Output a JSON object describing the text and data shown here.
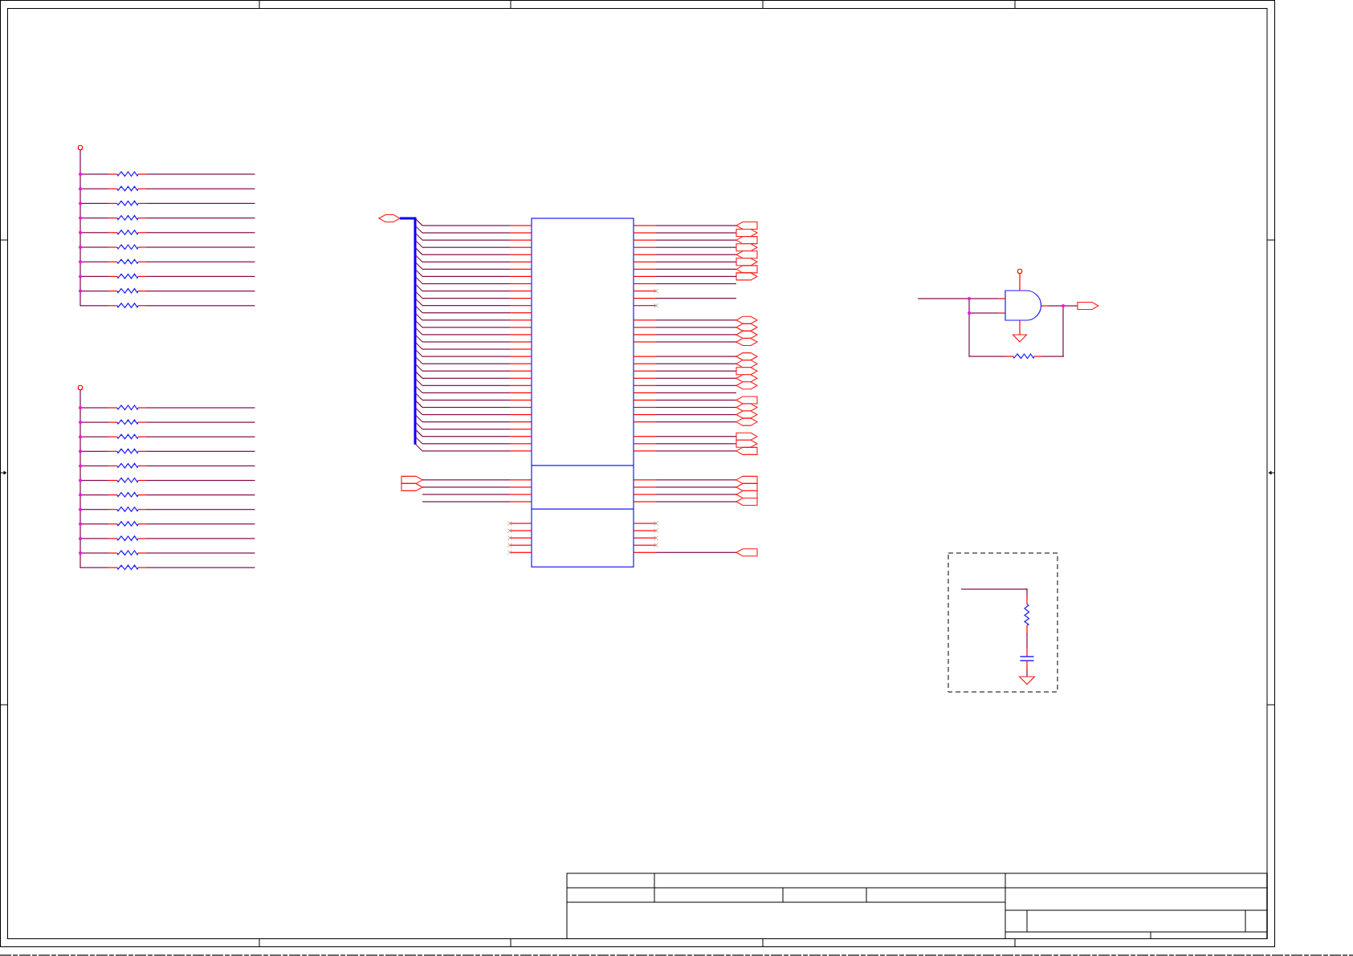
{
  "pullup_banks": [
    {
      "resistors": [
        {
          "junction": true
        },
        {
          "junction": true
        },
        {
          "junction": true
        },
        {
          "junction": true
        },
        {
          "junction": true
        },
        {
          "junction": true
        },
        {
          "junction": true
        },
        {
          "junction": true
        },
        {
          "junction": true
        },
        {
          "junction": false
        }
      ]
    },
    {
      "resistors": [
        {
          "junction": true
        },
        {
          "junction": true
        },
        {
          "junction": true
        },
        {
          "junction": true
        },
        {
          "junction": true
        },
        {
          "junction": true
        },
        {
          "junction": true
        },
        {
          "junction": true
        },
        {
          "junction": true
        },
        {
          "junction": true
        },
        {
          "junction": true
        },
        {
          "junction": false
        }
      ]
    }
  ],
  "chip": {
    "bus_port": {
      "kind": "port-bidir"
    },
    "sections": [
      {
        "left_pins": [
          {
            "kind": "bus"
          },
          {
            "kind": "bus"
          },
          {
            "kind": "bus"
          },
          {
            "kind": "bus"
          },
          {
            "kind": "bus"
          },
          {
            "kind": "bus"
          },
          {
            "kind": "bus"
          },
          {
            "kind": "bus"
          },
          {
            "kind": "bus"
          },
          {
            "kind": "bus"
          },
          {
            "kind": "bus"
          },
          {
            "kind": "bus"
          },
          {
            "kind": "bus"
          },
          {
            "kind": "bus"
          },
          {
            "kind": "bus"
          },
          {
            "kind": "bus"
          },
          {
            "kind": "bus"
          },
          {
            "kind": "bus"
          },
          {
            "kind": "bus"
          },
          {
            "kind": "bus"
          },
          {
            "kind": "bus"
          },
          {
            "kind": "bus"
          },
          {
            "kind": "bus"
          },
          {
            "kind": "bus"
          },
          {
            "kind": "bus"
          },
          {
            "kind": "bus"
          },
          {
            "kind": "bus"
          },
          {
            "kind": "bus"
          },
          {
            "kind": "bus"
          },
          {
            "kind": "bus"
          },
          {
            "kind": "bus"
          },
          {
            "kind": "bus"
          }
        ],
        "right_pins": [
          {
            "kind": "port-in"
          },
          {
            "kind": "port-out"
          },
          {
            "kind": "port-in"
          },
          {
            "kind": "port-out"
          },
          {
            "kind": "port-in"
          },
          {
            "kind": "port-out"
          },
          {
            "kind": "port-in"
          },
          {
            "kind": "port-out"
          },
          {
            "kind": "wire"
          },
          {
            "kind": "no-connect"
          },
          {
            "kind": "wire"
          },
          {
            "kind": "no-connect"
          },
          {
            "kind": "empty"
          },
          {
            "kind": "port-bidir"
          },
          {
            "kind": "port-bidir"
          },
          {
            "kind": "port-bidir"
          },
          {
            "kind": "port-bidir"
          },
          {
            "kind": "empty"
          },
          {
            "kind": "port-bidir"
          },
          {
            "kind": "port-bidir"
          },
          {
            "kind": "port-out"
          },
          {
            "kind": "port-bidir"
          },
          {
            "kind": "port-bidir"
          },
          {
            "kind": "wire"
          },
          {
            "kind": "port-in"
          },
          {
            "kind": "port-bidir"
          },
          {
            "kind": "port-bidir"
          },
          {
            "kind": "port-bidir"
          },
          {
            "kind": "empty"
          },
          {
            "kind": "port-out"
          },
          {
            "kind": "port-out"
          },
          {
            "kind": "port-in"
          }
        ]
      },
      {
        "left_pins": [
          {
            "kind": "port-out"
          },
          {
            "kind": "port-out"
          },
          {
            "kind": "wire"
          },
          {
            "kind": "wire"
          }
        ],
        "right_pins": [
          {
            "kind": "port-in"
          },
          {
            "kind": "port-in"
          },
          {
            "kind": "port-in"
          },
          {
            "kind": "port-in"
          }
        ]
      },
      {
        "left_pins": [
          {
            "kind": "no-connect"
          },
          {
            "kind": "no-connect"
          },
          {
            "kind": "no-connect"
          },
          {
            "kind": "no-connect"
          },
          {
            "kind": "no-connect"
          }
        ],
        "right_pins": [
          {
            "kind": "no-connect"
          },
          {
            "kind": "no-connect"
          },
          {
            "kind": "no-connect"
          },
          {
            "kind": "no-connect"
          },
          {
            "kind": "port-in"
          }
        ]
      }
    ]
  },
  "gate": {
    "kind": "and",
    "output_port": {
      "kind": "port-out"
    }
  },
  "rc_filter": {
    "parts": [
      {
        "kind": "resistor"
      },
      {
        "kind": "capacitor"
      },
      {
        "kind": "ground"
      }
    ]
  }
}
